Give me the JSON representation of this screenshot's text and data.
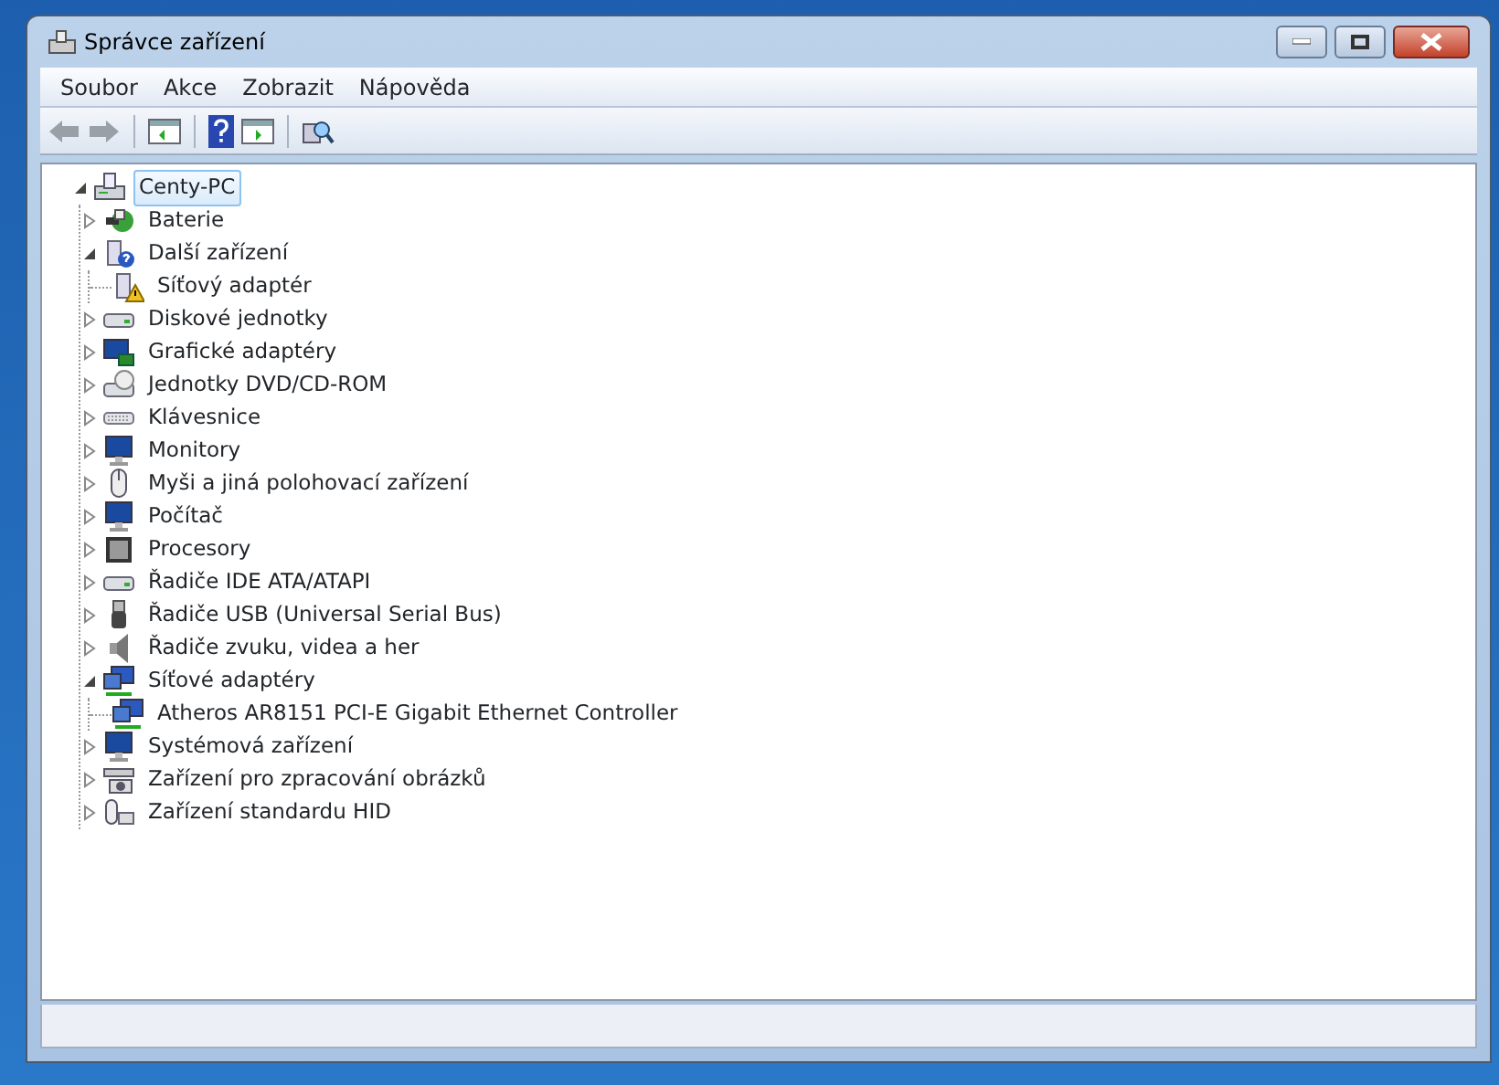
{
  "window": {
    "title": "Správce zařízení"
  },
  "menu": [
    "Soubor",
    "Akce",
    "Zobrazit",
    "Nápověda"
  ],
  "tree": {
    "label": "Centy-PC",
    "kind": "computer",
    "expanded": true,
    "selected": true,
    "children": [
      {
        "label": "Baterie",
        "kind": "battery",
        "expanded": false
      },
      {
        "label": "Další zařízení",
        "kind": "unknown",
        "expanded": true,
        "children": [
          {
            "label": "Síťový adaptér",
            "kind": "warning"
          }
        ]
      },
      {
        "label": "Diskové jednotky",
        "kind": "disk",
        "expanded": false
      },
      {
        "label": "Grafické adaptéry",
        "kind": "display",
        "expanded": false
      },
      {
        "label": "Jednotky DVD/CD-ROM",
        "kind": "dvd",
        "expanded": false
      },
      {
        "label": "Klávesnice",
        "kind": "keyboard",
        "expanded": false
      },
      {
        "label": "Monitory",
        "kind": "monitor",
        "expanded": false
      },
      {
        "label": "Myši a jiná polohovací zařízení",
        "kind": "mouse",
        "expanded": false
      },
      {
        "label": "Počítač",
        "kind": "monitor",
        "expanded": false
      },
      {
        "label": "Procesory",
        "kind": "cpu",
        "expanded": false
      },
      {
        "label": "Řadiče IDE ATA/ATAPI",
        "kind": "disk",
        "expanded": false
      },
      {
        "label": "Řadiče USB (Universal Serial Bus)",
        "kind": "usb",
        "expanded": false
      },
      {
        "label": "Řadiče zvuku, videa a her",
        "kind": "sound",
        "expanded": false
      },
      {
        "label": "Síťové adaptéry",
        "kind": "network",
        "expanded": true,
        "children": [
          {
            "label": "Atheros AR8151 PCI-E Gigabit Ethernet Controller",
            "kind": "network"
          }
        ]
      },
      {
        "label": "Systémová zařízení",
        "kind": "monitor",
        "expanded": false
      },
      {
        "label": "Zařízení pro zpracování obrázků",
        "kind": "camera",
        "expanded": false
      },
      {
        "label": "Zařízení standardu HID",
        "kind": "hid",
        "expanded": false
      }
    ]
  }
}
